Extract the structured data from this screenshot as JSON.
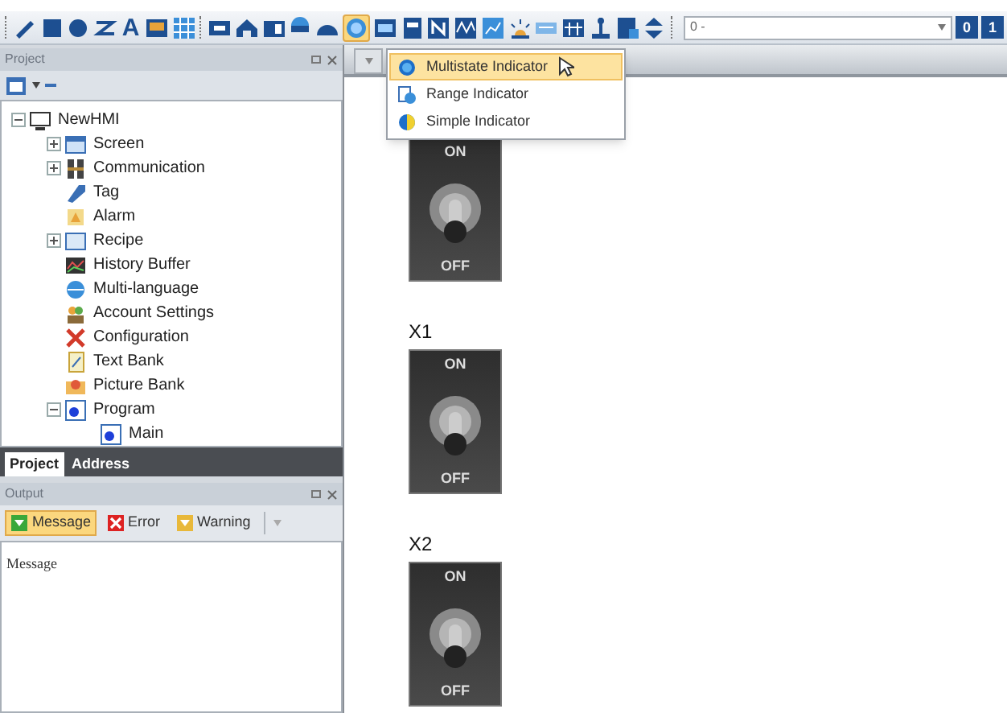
{
  "toolbar": {
    "items": [
      {
        "kind": "icon"
      },
      {
        "kind": "icon"
      },
      {
        "kind": "icon"
      },
      {
        "kind": "icon"
      },
      {
        "kind": "glyph",
        "text": "A"
      },
      {
        "kind": "icon"
      },
      {
        "kind": "icon"
      },
      {
        "kind": "sep"
      },
      {
        "kind": "icon"
      },
      {
        "kind": "icon"
      },
      {
        "kind": "icon"
      },
      {
        "kind": "icon"
      },
      {
        "kind": "icon"
      },
      {
        "kind": "icon",
        "selected": true
      },
      {
        "kind": "icon"
      },
      {
        "kind": "icon"
      },
      {
        "kind": "icon"
      },
      {
        "kind": "icon"
      },
      {
        "kind": "icon"
      },
      {
        "kind": "icon"
      },
      {
        "kind": "icon"
      },
      {
        "kind": "icon"
      },
      {
        "kind": "icon"
      },
      {
        "kind": "icon"
      },
      {
        "kind": "icon"
      },
      {
        "kind": "sep"
      }
    ],
    "combo": {
      "value": "0 -"
    },
    "buttons": [
      "0",
      "1"
    ]
  },
  "project_panel": {
    "title": "Project",
    "tree": [
      {
        "label": "NewHMI",
        "expanded": true,
        "children": [
          {
            "label": "Screen",
            "expanded": false
          },
          {
            "label": "Communication",
            "expanded": false
          },
          {
            "label": "Tag"
          },
          {
            "label": "Alarm"
          },
          {
            "label": "Recipe",
            "expanded": false
          },
          {
            "label": "History Buffer"
          },
          {
            "label": "Multi-language"
          },
          {
            "label": "Account Settings"
          },
          {
            "label": "Configuration"
          },
          {
            "label": "Text Bank"
          },
          {
            "label": "Picture Bank"
          },
          {
            "label": "Program",
            "expanded": true,
            "children": [
              {
                "label": "Main"
              }
            ]
          }
        ]
      }
    ],
    "tabs": [
      {
        "label": "Project",
        "selected": true
      },
      {
        "label": "Address",
        "selected": false
      }
    ]
  },
  "output_panel": {
    "title": "Output",
    "filters": [
      {
        "label": "Message",
        "selected": true,
        "kind": "message"
      },
      {
        "label": "Error",
        "selected": false,
        "kind": "error"
      },
      {
        "label": "Warning",
        "selected": false,
        "kind": "warning"
      }
    ],
    "column": "Message"
  },
  "menu": {
    "items": [
      {
        "label": "Multistate Indicator",
        "selected": true
      },
      {
        "label": "Range Indicator",
        "selected": false
      },
      {
        "label": "Simple Indicator",
        "selected": false
      }
    ]
  },
  "switches": [
    {
      "on_text": "ON",
      "off_text": "OFF",
      "on": false
    },
    {
      "label": "X1",
      "on_text": "ON",
      "off_text": "OFF",
      "on": false
    },
    {
      "label": "X2",
      "on_text": "ON",
      "off_text": "OFF",
      "on": false
    }
  ]
}
